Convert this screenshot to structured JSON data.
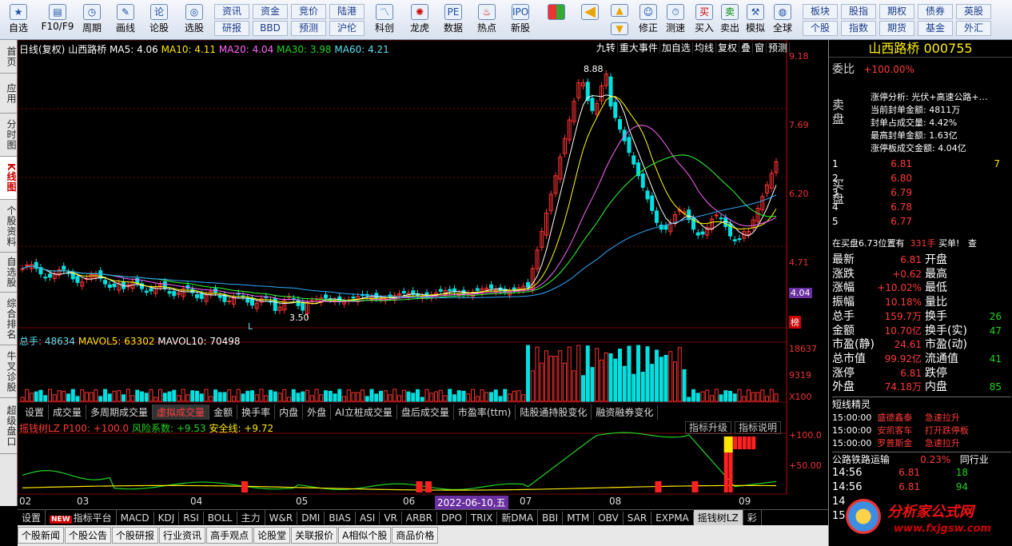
{
  "toolbar": {
    "main_buttons": [
      "自选",
      "F10/F9",
      "周期",
      "画线",
      "论股",
      "选股"
    ],
    "small_buttons_row1": [
      "资讯",
      "资金",
      "竞价",
      "陆港"
    ],
    "small_buttons_row2": [
      "研报",
      "BBD",
      "预测",
      "沪伦"
    ],
    "big_buttons": [
      "科创",
      "龙虎",
      "数据",
      "热点",
      "新股"
    ],
    "nav_buttons": [
      "修正",
      "测速",
      "买入",
      "卖出",
      "模拟",
      "全球"
    ],
    "right_row1": [
      "板块",
      "股指",
      "期权",
      "债券",
      "英股"
    ],
    "right_row2": [
      "个股",
      "指数",
      "期货",
      "基金",
      "外汇"
    ]
  },
  "left_tabs": [
    {
      "label": "首页",
      "active": false
    },
    {
      "label": "应用",
      "active": false
    },
    {
      "label": "分时图",
      "active": false
    },
    {
      "label": "K线图",
      "active": true
    },
    {
      "label": "个股资料",
      "active": false
    },
    {
      "label": "自选股",
      "active": false
    },
    {
      "label": "综合排名",
      "active": false
    },
    {
      "label": "牛叉诊股",
      "active": false
    },
    {
      "label": "超级盘口",
      "active": false
    }
  ],
  "chart": {
    "header": {
      "period": "日线(复权)",
      "stock": "山西路桥",
      "ma5": "MA5: 4.06",
      "ma10": "MA10: 4.11",
      "ma20": "MA20: 4.04",
      "ma30": "MA30: 3.98",
      "ma60": "MA60: 4.21"
    },
    "top_menu": [
      "九转",
      "重大事件",
      "加自选",
      "均线",
      "复权",
      "叠",
      "窗",
      "预测"
    ],
    "price_axis": [
      "9.18",
      "7.69",
      "6.20",
      "4.71",
      "4.04"
    ],
    "volume_axis": [
      "18637",
      "9319",
      "X100"
    ],
    "indicator_axis": [
      "+100.0",
      "+50.00"
    ],
    "high_mark": "8.88",
    "low_mark": "3.50",
    "low_flag": "L",
    "rank_flag": "榜",
    "volume_header": {
      "total": "总手: 48634",
      "mavol5": "MAVOL5: 63302",
      "mavol10": "MAVOL10: 70498"
    },
    "sub_tabs": [
      "设置",
      "成交量",
      "多周期成交量",
      "虚拟成交量",
      "金额",
      "换手率",
      "内盘",
      "外盘",
      "AI立桩成交量",
      "盘后成交量",
      "市盈率(ttm)",
      "陆股通持股变化",
      "融资融券变化"
    ],
    "active_sub_tab": "虚拟成交量",
    "indicator_header": {
      "name": "摇钱树LZ",
      "p": "P100: +100.0",
      "risk": "风险系数: +9.53",
      "safe": "安全线: +9.72"
    },
    "indicator_buttons": [
      "指标升级",
      "指标说明"
    ],
    "x_labels": [
      "02",
      "03",
      "04",
      "05",
      "06",
      "07",
      "08",
      "09"
    ],
    "cursor_date": "2022-06-10,五",
    "colors": {
      "up": "#ff3232",
      "down": "#00e0e0",
      "ma5": "#ffffff",
      "ma10": "#ffff00",
      "ma20": "#ff66ff",
      "ma30": "#33ff33",
      "ma60": "#33aaff"
    }
  },
  "bottom_tabs": [
    "设置",
    "指标平台",
    "MACD",
    "KDJ",
    "RSI",
    "BOLL",
    "主力",
    "W&R",
    "DMI",
    "BIAS",
    "ASI",
    "VR",
    "ARBR",
    "DPO",
    "TRIX",
    "新DMA",
    "BBI",
    "MTM",
    "OBV",
    "SAR",
    "EXPMA",
    "摇钱树LZ",
    "彩"
  ],
  "active_bottom_tab": "摇钱树LZ",
  "bottom_links": [
    "个股新闻",
    "个股公告",
    "个股研报",
    "行业资讯",
    "高手观点",
    "论股堂",
    "关联报价",
    "A相似个股",
    "商品价格"
  ],
  "quote": {
    "title": "山西路桥 000755",
    "weibi_label": "委比",
    "weibi_value": "+100.00%",
    "sell_label": "卖盘",
    "buy_label": "买盘",
    "analysis_title": "涨停分析: 光伏+高速公路+…",
    "analysis_lines": [
      "当前封单金额: 4811万",
      "封单占成交量: 4.42%",
      "最高封单金额: 1.63亿",
      "涨停板成交金额: 4.04亿"
    ],
    "buy_levels": [
      {
        "n": "1",
        "price": "6.81",
        "vol": "7"
      },
      {
        "n": "2",
        "price": "6.80",
        "vol": ""
      },
      {
        "n": "3",
        "price": "6.79",
        "vol": ""
      },
      {
        "n": "4",
        "price": "6.78",
        "vol": ""
      },
      {
        "n": "5",
        "price": "6.77",
        "vol": ""
      }
    ],
    "buy_note": "在买盘6.73位置有",
    "buy_note_vol": "331手",
    "buy_note_tail": "买单!",
    "buy_note_btn": "查",
    "stats": [
      {
        "l": "最新",
        "v": "6.81",
        "l2": "开盘",
        "v2": ""
      },
      {
        "l": "涨跌",
        "v": "+0.62",
        "l2": "最高",
        "v2": ""
      },
      {
        "l": "涨幅",
        "v": "+10.02%",
        "l2": "最低",
        "v2": ""
      },
      {
        "l": "振幅",
        "v": "10.18%",
        "l2": "量比",
        "v2": ""
      },
      {
        "l": "总手",
        "v": "159.7万",
        "l2": "换手",
        "v2": "26"
      },
      {
        "l": "金额",
        "v": "10.70亿",
        "l2": "换手(实)",
        "v2": "47"
      },
      {
        "l": "市盈(静)",
        "v": "24.61",
        "l2": "市盈(动)",
        "v2": ""
      },
      {
        "l": "总市值",
        "v": "99.92亿",
        "l2": "流通值",
        "v2": "41"
      },
      {
        "l": "涨停",
        "v": "6.81",
        "l2": "跌停",
        "v2": ""
      },
      {
        "l": "外盘",
        "v": "74.18万",
        "l2": "内盘",
        "v2": "85"
      }
    ],
    "genie_title": "短线精灵",
    "genie": [
      {
        "t": "15:00:00",
        "name": "盛德鑫泰",
        "act": "急速拉升"
      },
      {
        "t": "15:00:00",
        "name": "安凯客车",
        "act": "打开跌停板"
      },
      {
        "t": "15:00:00",
        "name": "罗普斯金",
        "act": "急速拉升"
      }
    ],
    "sector_name": "公路铁路运输",
    "sector_pct": "0.23%",
    "sector_link": "同行业",
    "ticks": [
      {
        "t": "14:56",
        "p": "6.81",
        "v": "18"
      },
      {
        "t": "14:56",
        "p": "6.81",
        "v": "94"
      },
      {
        "t": "14",
        "p": "",
        "v": ""
      },
      {
        "t": "15",
        "p": "",
        "v": ""
      }
    ]
  },
  "watermark": {
    "text": "分析家公式网",
    "url": "www.fxjgsw.com"
  }
}
